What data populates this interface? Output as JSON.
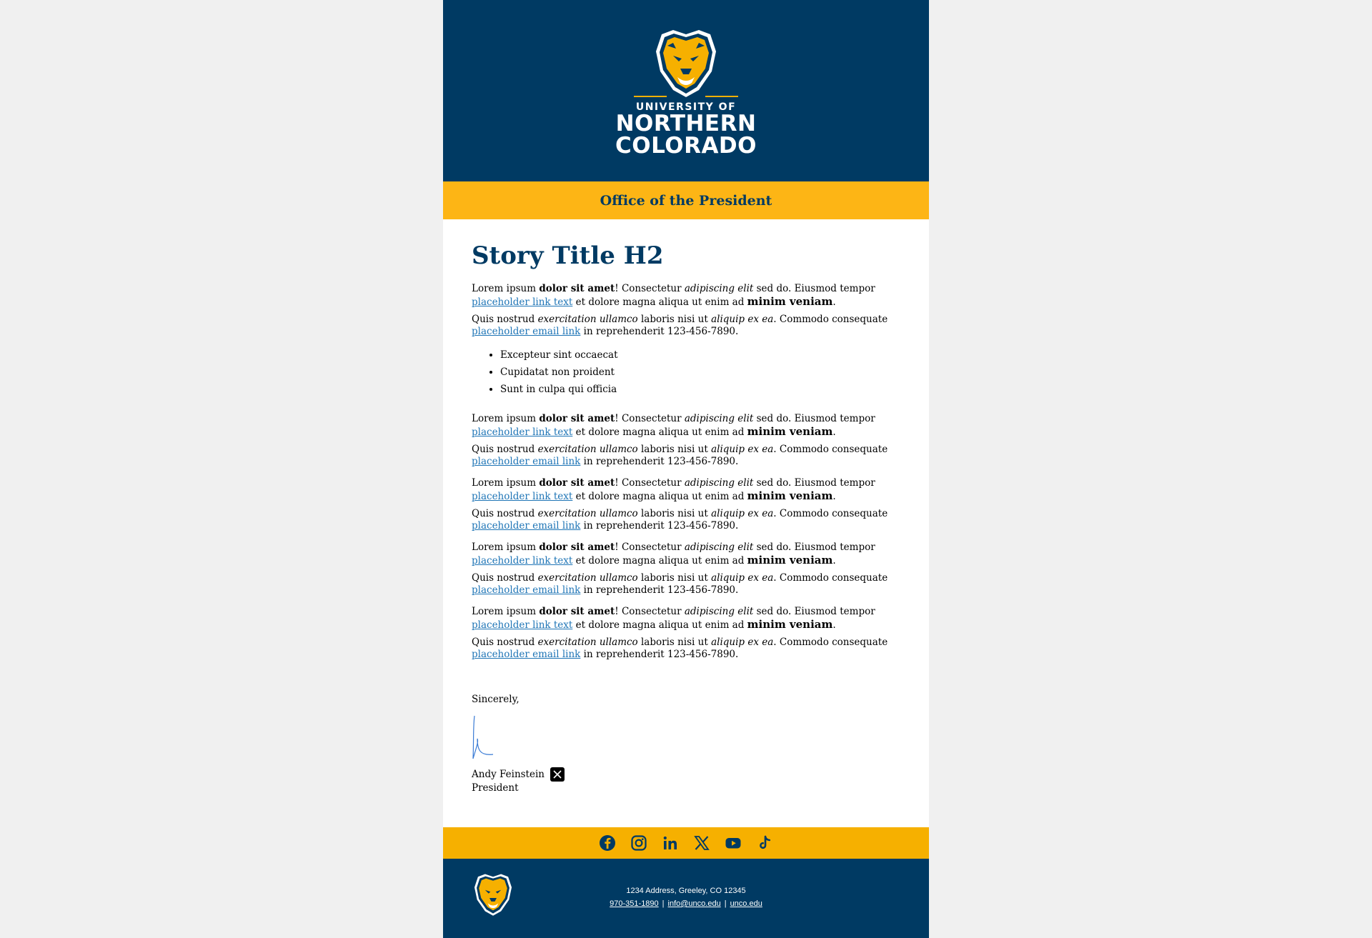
{
  "header": {
    "logo_line1": "UNIVERSITY OF",
    "logo_line2": "NORTHERN",
    "logo_line3": "COLORADO",
    "office": "Office of the President"
  },
  "story": {
    "title": "Story Title H2",
    "p1": {
      "t1": "Lorem ipsum ",
      "b1": "dolor sit amet",
      "t2": "! Consectetur ",
      "i1": "adipiscing elit",
      "t3": " sed do. Eiusmod tempor ",
      "link": "placeholder link text",
      "t4": " et dolore magna aliqua ut enim ad ",
      "b2": "minim veniam",
      "t5": "."
    },
    "p2": {
      "t1": "Quis nostrud ",
      "i1": "exercitation ullamco",
      "t2": " laboris nisi ut ",
      "i2": "aliquip ex ea",
      "t3": ". Commodo consequate ",
      "link": "placeholder email link",
      "t4": " in reprehenderit 123-456-7890."
    },
    "bullets": [
      "Excepteur sint occaecat",
      "Cupidatat non proident",
      "Sunt in culpa qui officia"
    ]
  },
  "signature": {
    "closing": "Sincerely,",
    "name": "Andy Feinstein",
    "title": "President"
  },
  "social": [
    "facebook-icon",
    "instagram-icon",
    "linkedin-icon",
    "x-icon",
    "youtube-icon",
    "tiktok-icon"
  ],
  "footer": {
    "address": "1234 Address, Greeley, CO 12345",
    "phone": "970-351-1890",
    "email": "info@unco.edu",
    "site": "unco.edu"
  },
  "colors": {
    "navy": "#003a63",
    "gold": "#fdb515",
    "link": "#1f75b6"
  }
}
